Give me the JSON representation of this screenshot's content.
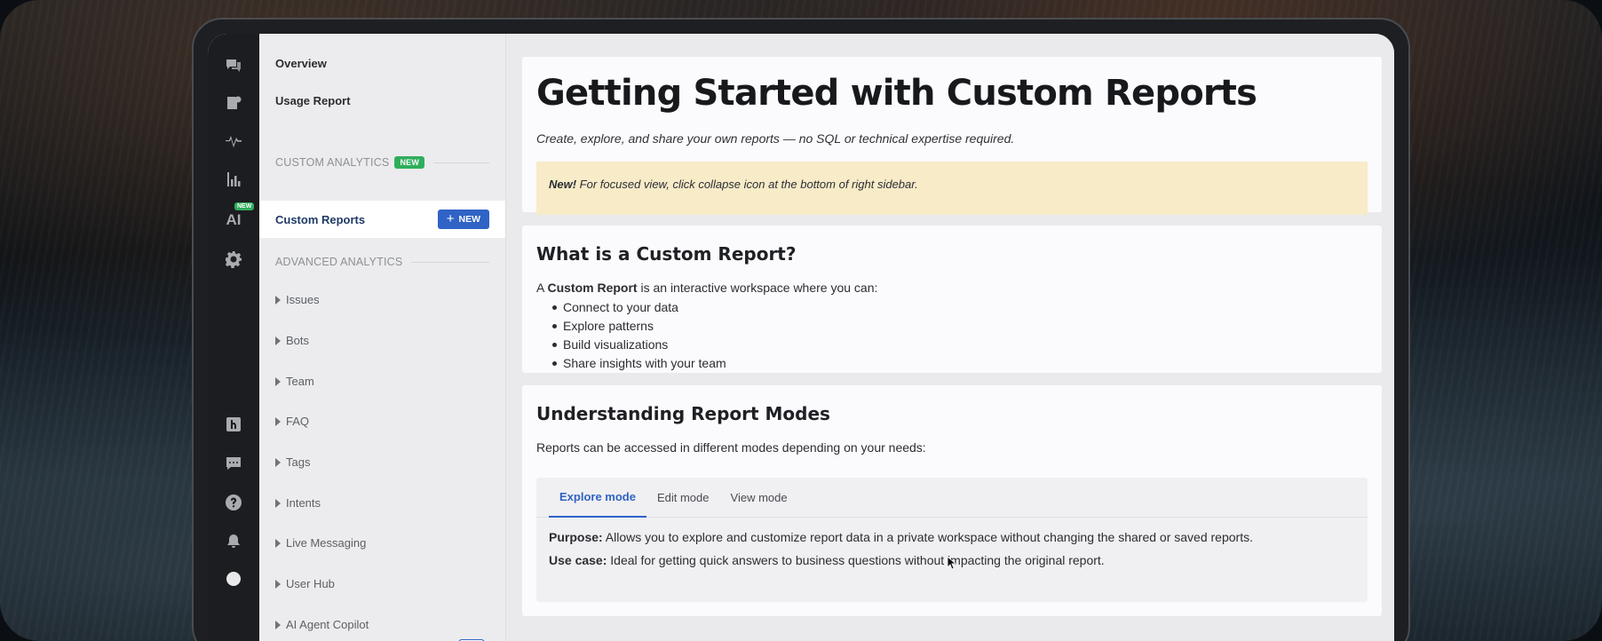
{
  "rail": {
    "icons": [
      "chat-bubbles-icon",
      "book-icon",
      "activity-icon",
      "bar-chart-icon",
      "ai-icon",
      "gear-icon",
      "helpdesk-icon",
      "message-icon",
      "help-icon",
      "bell-icon",
      "avatar"
    ],
    "ai_label": "AI",
    "ai_badge": "NEW"
  },
  "nav": {
    "overview": "Overview",
    "usage_report": "Usage Report",
    "custom_analytics_heading": "CUSTOM ANALYTICS",
    "custom_analytics_badge": "NEW",
    "custom_reports": "Custom Reports",
    "new_button": "NEW",
    "advanced_analytics_heading": "ADVANCED ANALYTICS",
    "items": [
      {
        "label": "Issues"
      },
      {
        "label": "Bots"
      },
      {
        "label": "Team"
      },
      {
        "label": "FAQ"
      },
      {
        "label": "Tags"
      },
      {
        "label": "Intents"
      },
      {
        "label": "Live Messaging"
      },
      {
        "label": "User Hub"
      },
      {
        "label": "AI Agent Copilot"
      }
    ]
  },
  "main": {
    "title": "Getting Started with Custom Reports",
    "subtitle": "Create, explore, and share your own reports — no SQL or technical expertise required.",
    "callout_bold": "New!",
    "callout_text": " For focused view, click collapse icon at the bottom of right sidebar.",
    "section1": {
      "heading": "What is a Custom Report?",
      "intro_prefix": "A ",
      "intro_bold": "Custom Report",
      "intro_suffix": " is an interactive workspace where you can:",
      "bullets": [
        "Connect to your data",
        "Explore patterns",
        "Build visualizations",
        "Share insights with your team"
      ]
    },
    "section2": {
      "heading": "Understanding Report Modes",
      "intro": "Reports can be accessed in different modes depending on your needs:",
      "tabs": [
        "Explore mode",
        "Edit mode",
        "View mode"
      ],
      "purpose_label": "Purpose:",
      "purpose_text": " Allows you to explore and customize report data in a private workspace without changing the shared or saved reports.",
      "usecase_label": "Use case:",
      "usecase_text": " Ideal for getting quick answers to business questions without impacting the original report."
    }
  },
  "colors": {
    "accent": "#2f63c5",
    "badge_green": "#2fae5b",
    "callout_bg": "#f7ebc8",
    "rail_bg": "#1c1d20"
  }
}
